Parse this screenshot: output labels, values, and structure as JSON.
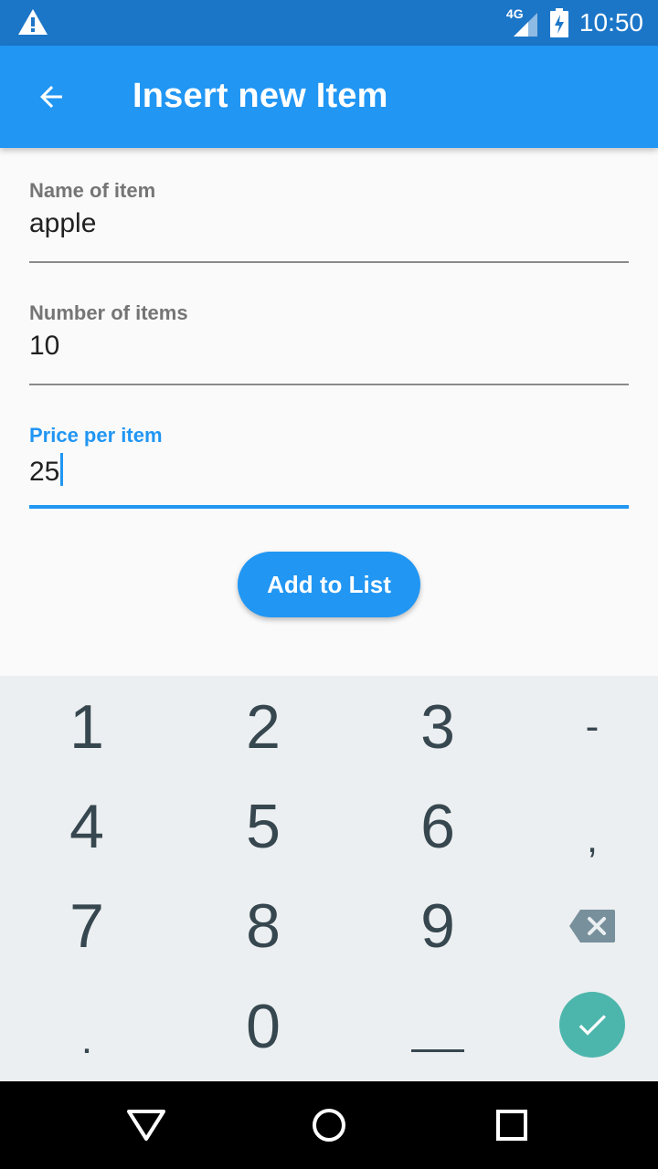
{
  "status_bar": {
    "time": "10:50",
    "network": "4G",
    "icons": [
      "warning-icon",
      "cell-signal-icon",
      "battery-charging-icon"
    ]
  },
  "app_bar": {
    "title": "Insert new Item",
    "back_icon": "arrow-back-icon"
  },
  "form": {
    "fields": [
      {
        "label": "Name of item",
        "value": "apple",
        "focused": false
      },
      {
        "label": "Number of items",
        "value": "10",
        "focused": false
      },
      {
        "label": "Price per item",
        "value": "25",
        "focused": true
      }
    ],
    "submit_label": "Add to List"
  },
  "keyboard": {
    "rows": [
      [
        "1",
        "2",
        "3",
        "-"
      ],
      [
        "4",
        "5",
        "6",
        ","
      ],
      [
        "7",
        "8",
        "9",
        "backspace"
      ],
      [
        ".",
        "0",
        "space",
        "done"
      ]
    ],
    "icons": [
      "backspace-icon",
      "space-bar-icon",
      "check-icon"
    ]
  },
  "nav_bar": {
    "icons": [
      "back-triangle-icon",
      "home-circle-icon",
      "recents-square-icon"
    ]
  },
  "colors": {
    "status_bar": "#1c76c8",
    "primary": "#2196f3",
    "keyboard_bg": "#eceff1",
    "key_text": "#37474f",
    "done_key": "#4db6ac",
    "label_gray": "#757575"
  }
}
